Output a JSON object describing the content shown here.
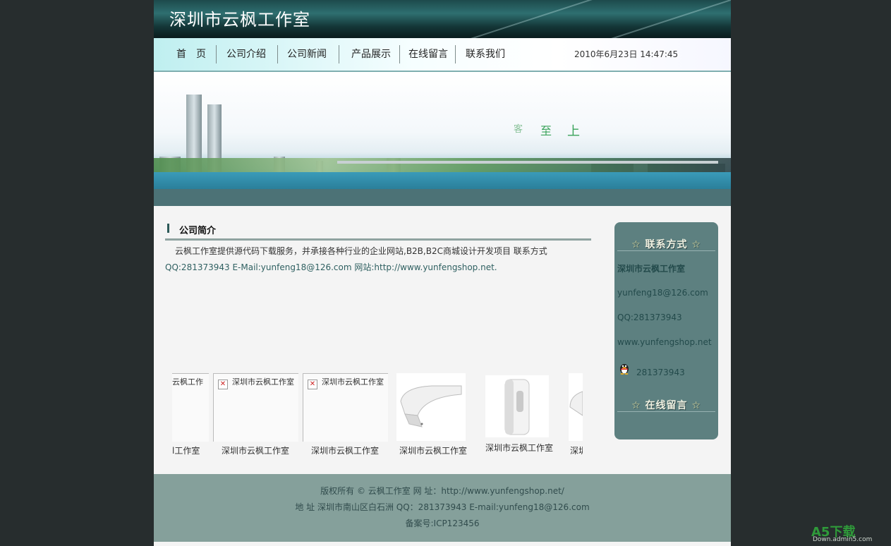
{
  "site": {
    "title": "深圳市云枫工作室"
  },
  "nav": {
    "items": [
      "首　页",
      "公司介绍",
      "公司新闻",
      "产品展示",
      "在线留言",
      "联系我们"
    ],
    "date": "2010年6月23日 14:47:45"
  },
  "banner": {
    "slogan": [
      "客",
      "至",
      "上"
    ]
  },
  "intro": {
    "title": "公司简介",
    "line1": "云枫工作室提供源代码下载服务，并承接各种行业的企业网站,B2B,B2C商城设计开发项目 联系方式",
    "line2": "QQ:281373943 E-Mail:yunfeng18@126.com 网站:http://www.yunfengshop.net."
  },
  "products": [
    {
      "boxtext": "云枫工作",
      "caption": "l工作室"
    },
    {
      "boxtext": "深圳市云枫工作室",
      "caption": "深圳市云枫工作室"
    },
    {
      "boxtext": "深圳市云枫工作室",
      "caption": "深圳市云枫工作室"
    },
    {
      "boxtext": "",
      "caption": "深圳市云枫工作室"
    },
    {
      "boxtext": "",
      "caption": "深圳市云枫工作室"
    },
    {
      "boxtext": "",
      "caption": "深圳"
    }
  ],
  "sidebar": {
    "contact_title": "联系方式",
    "company": "深圳市云枫工作室",
    "email": "yunfeng18@126.com",
    "qq": "QQ:281373943",
    "website": "www.yunfengshop.net",
    "qq_number": "281373943",
    "message_title": "在线留言",
    "star": "☆"
  },
  "footer": {
    "copyright": "版权所有 © 云枫工作室 网 址：http://www.yunfengshop.net/",
    "address": "地 址 深圳市南山区白石洲 QQ：281373943 E-mail:yunfeng18@126.com",
    "icp": "备案号:ICP123456"
  },
  "watermark": {
    "logo": "A5下载",
    "sub": "Down.admin5.com"
  }
}
